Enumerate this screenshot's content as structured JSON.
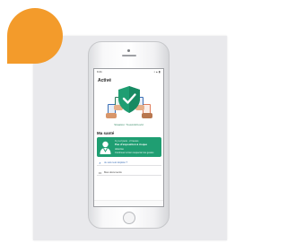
{
  "screen": {
    "status_time": "9:41",
    "status_icons": "▪ ▴ ▮",
    "title": "Activé",
    "hero_caption": "Situation: TousAntiCovid",
    "section_title": "Ma santé",
    "card": {
      "line1": "Il y a 2 jours · 2 heures",
      "line2": "Pas d'exposition à risque",
      "line3": "détectée",
      "line4": "Continuez à bien respecter les gestes"
    },
    "row1": "Je suis test dépisté ?",
    "row2": "Mes documents"
  },
  "colors": {
    "accent_orange": "#f39b2b",
    "card_green": "#1f9e72",
    "link_blue": "#3b6fb6"
  },
  "icons": {
    "shield": "shield-check-icon",
    "hand_phone": "hand-phone-icon",
    "doctor": "doctor-icon",
    "search": "search-icon",
    "document": "document-icon"
  }
}
